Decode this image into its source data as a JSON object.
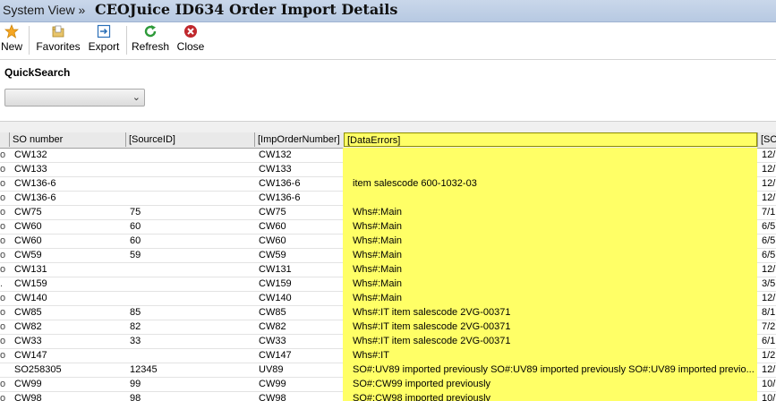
{
  "titlebar": {
    "breadcrumb": "System View »",
    "title": "CEOJuice ID634 Order Import Details"
  },
  "toolbar": {
    "new": "New",
    "favorites": "Favorites",
    "export": "Export",
    "refresh": "Refresh",
    "close": "Close",
    "icons": {
      "new": "star-icon",
      "favorites": "favorites-folder-icon",
      "export": "export-icon",
      "refresh": "refresh-icon",
      "close": "close-icon"
    }
  },
  "quicksearch": {
    "label": "QuickSearch",
    "value": ""
  },
  "grid": {
    "headers": [
      "SO number",
      "[SourceID]",
      "[ImpOrderNumber]",
      "[DataErrors]",
      "[SO"
    ],
    "highlight_color": "#ffff66",
    "rows": [
      {
        "ind": "o",
        "so": "CW132",
        "src": "",
        "imp": "CW132",
        "err": "",
        "s2": "12/"
      },
      {
        "ind": "o",
        "so": "CW133",
        "src": "",
        "imp": "CW133",
        "err": "",
        "s2": "12/"
      },
      {
        "ind": "o",
        "so": "CW136-6",
        "src": "",
        "imp": "CW136-6",
        "err": "item salescode 600-1032-03",
        "s2": "12/"
      },
      {
        "ind": "o",
        "so": "CW136-6",
        "src": "",
        "imp": "CW136-6",
        "err": "",
        "s2": "12/"
      },
      {
        "ind": "o",
        "so": "CW75",
        "src": "75",
        "imp": "CW75",
        "err": "Whs#:Main",
        "s2": "7/1"
      },
      {
        "ind": "o",
        "so": "CW60",
        "src": "60",
        "imp": "CW60",
        "err": "Whs#:Main",
        "s2": "6/5"
      },
      {
        "ind": "o",
        "so": "CW60",
        "src": "60",
        "imp": "CW60",
        "err": "Whs#:Main",
        "s2": "6/5"
      },
      {
        "ind": "o",
        "so": "CW59",
        "src": "59",
        "imp": "CW59",
        "err": "Whs#:Main",
        "s2": "6/5"
      },
      {
        "ind": "o",
        "so": "CW131",
        "src": "",
        "imp": "CW131",
        "err": "Whs#:Main",
        "s2": "12/"
      },
      {
        "ind": ".",
        "so": "CW159",
        "src": "",
        "imp": "CW159",
        "err": "Whs#:Main",
        "s2": "3/5"
      },
      {
        "ind": "o",
        "so": "CW140",
        "src": "",
        "imp": "CW140",
        "err": "Whs#:Main",
        "s2": "12/"
      },
      {
        "ind": "o",
        "so": "CW85",
        "src": "85",
        "imp": "CW85",
        "err": "Whs#:IT item salescode 2VG-00371",
        "s2": "8/1"
      },
      {
        "ind": "o",
        "so": "CW82",
        "src": "82",
        "imp": "CW82",
        "err": "Whs#:IT item salescode 2VG-00371",
        "s2": "7/2"
      },
      {
        "ind": "o",
        "so": "CW33",
        "src": "33",
        "imp": "CW33",
        "err": "Whs#:IT item salescode 2VG-00371",
        "s2": "6/1"
      },
      {
        "ind": "o",
        "so": "CW147",
        "src": "",
        "imp": "CW147",
        "err": "Whs#:IT",
        "s2": "1/2"
      },
      {
        "ind": "",
        "so": "SO258305",
        "src": "12345",
        "imp": "UV89",
        "err": "SO#:UV89 imported previously SO#:UV89 imported previously SO#:UV89 imported previo...",
        "s2": "12/"
      },
      {
        "ind": "o",
        "so": "CW99",
        "src": "99",
        "imp": "CW99",
        "err": "SO#:CW99 imported previously",
        "s2": "10/"
      },
      {
        "ind": "o",
        "so": "CW98",
        "src": "98",
        "imp": "CW98",
        "err": "SO#:CW98 imported previously",
        "s2": "10/"
      }
    ]
  }
}
